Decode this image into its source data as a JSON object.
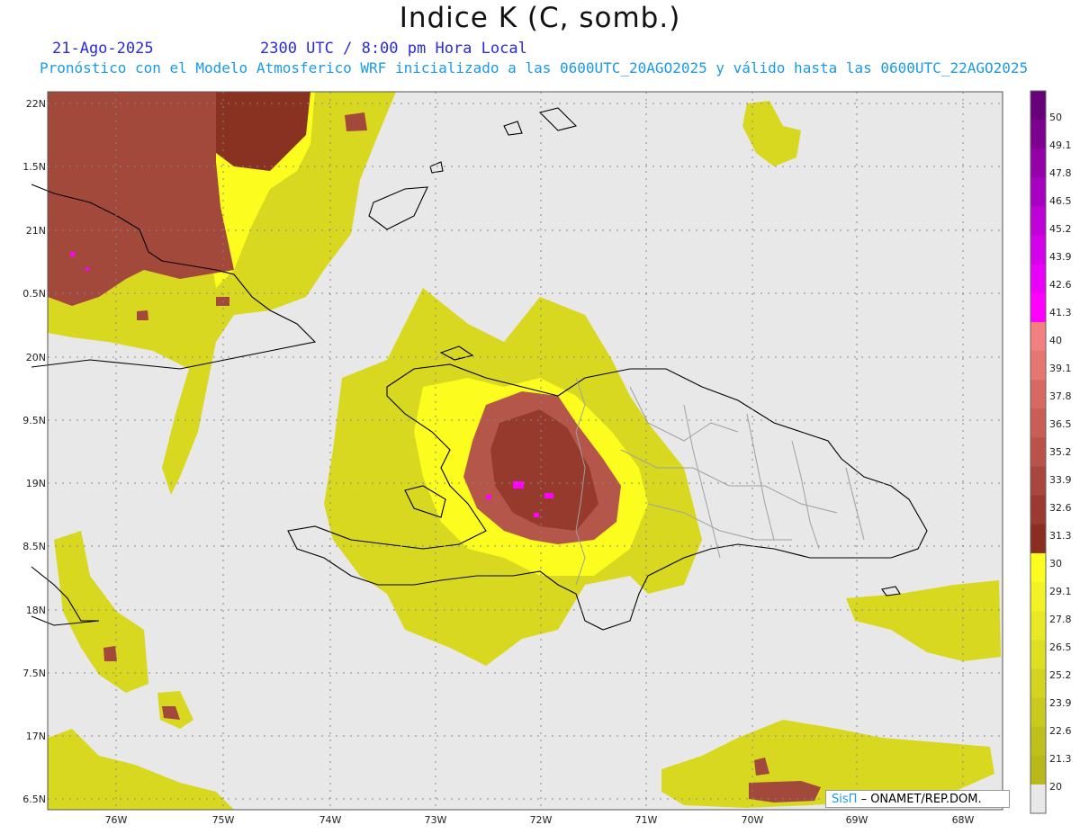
{
  "header": {
    "title": "Indice K (C, somb.)",
    "date": "21-Ago-2025",
    "time": "2300 UTC / 8:00 pm Hora Local",
    "subtitle": "Pronóstico con el Modelo Atmosferico WRF inicializado a las 0600UTC_20AGO2025 y válido hasta las  0600UTC_22AGO2025"
  },
  "axes": {
    "lat_labels": [
      "22N",
      "1.5N",
      "21N",
      "0.5N",
      "20N",
      "9.5N",
      "19N",
      "8.5N",
      "18N",
      "7.5N",
      "17N",
      "6.5N"
    ],
    "lon_labels": [
      "76W",
      "75W",
      "74W",
      "73W",
      "72W",
      "71W",
      "70W",
      "69W",
      "68W"
    ]
  },
  "colorbar": {
    "labels": [
      "50",
      "49.1",
      "47.8",
      "46.5",
      "45.2",
      "43.9",
      "42.6",
      "41.3",
      "40",
      "39.1",
      "37.8",
      "36.5",
      "35.2",
      "33.9",
      "32.6",
      "31.3",
      "30",
      "29.1",
      "27.8",
      "26.5",
      "25.2",
      "23.9",
      "22.6",
      "21.3",
      "20"
    ],
    "colors": [
      "#68007a",
      "#7d0090",
      "#9300a8",
      "#a800c0",
      "#bf00d6",
      "#d400ea",
      "#ea00f8",
      "#ff00ff",
      "#f28080",
      "#e57670",
      "#d66a62",
      "#c85e56",
      "#ba5249",
      "#aa4640",
      "#9a3a32",
      "#8a2e22",
      "#fcfc1e",
      "#f2f226",
      "#e8e824",
      "#dede22",
      "#d4d420",
      "#caca1e",
      "#c0c01c",
      "#b8b81a",
      "#e8e8e8"
    ]
  },
  "credit": {
    "brand": "SisΠ",
    "text": "– ONAMET/REP.DOM."
  },
  "colors": {
    "ocean": "#e8e8e8",
    "coast": "#000000",
    "provinces": "#a0a0a0",
    "grid": "#888888"
  }
}
